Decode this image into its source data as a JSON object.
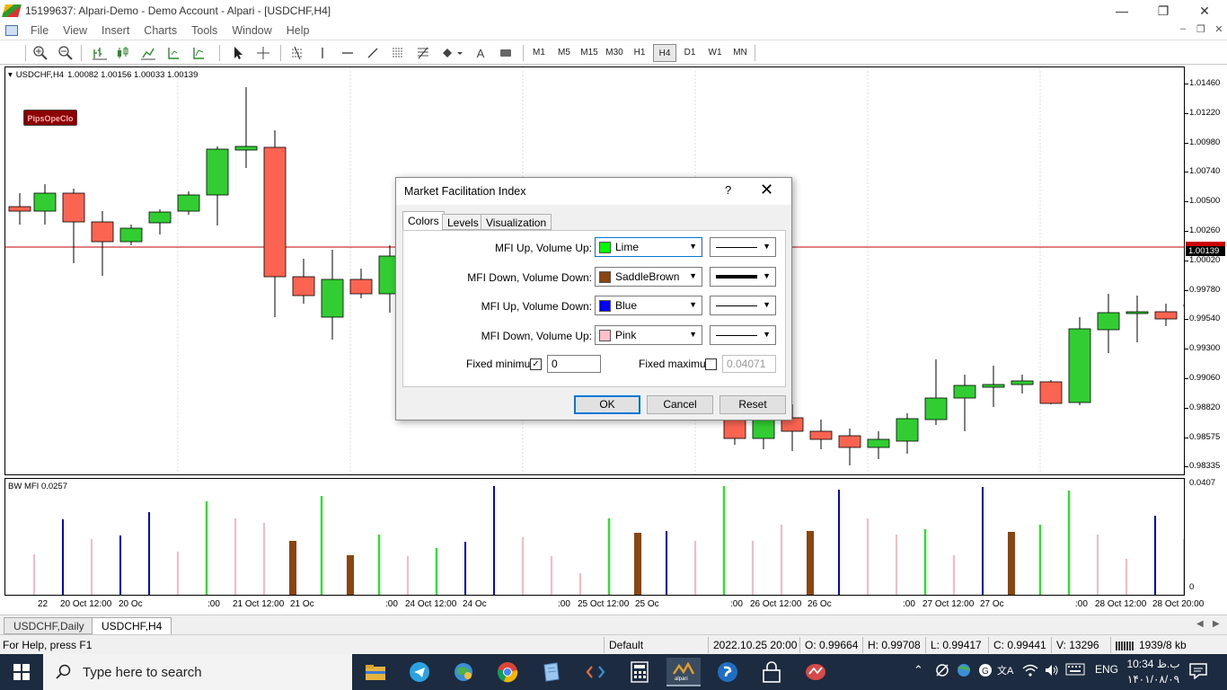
{
  "window": {
    "title": "15199637: Alpari-Demo - Demo Account - Alpari - [USDCHF,H4]",
    "minimize": "—",
    "maximize": "❐",
    "close": "✕"
  },
  "menu": {
    "items": [
      "File",
      "View",
      "Insert",
      "Charts",
      "Tools",
      "Window",
      "Help"
    ],
    "mdi_min": "–",
    "mdi_restore": "❐",
    "mdi_close": "✕"
  },
  "toolbar": {
    "timeframes": [
      "M1",
      "M5",
      "M15",
      "M30",
      "H1",
      "H4",
      "D1",
      "W1",
      "MN"
    ],
    "active_timeframe": "H4",
    "text_tool": "A"
  },
  "chart": {
    "header_symbol": "USDCHF,H4",
    "header_ohlc": "1.00082 1.00156 1.00033 1.00139",
    "badge": "PipsOpeClo",
    "current_price": "1.00139",
    "price_labels": [
      "1.01460",
      "1.01220",
      "1.00980",
      "1.00740",
      "1.00500",
      "1.00260",
      "1.00020",
      "0.99780",
      "0.99540",
      "0.99300",
      "0.99060",
      "0.98820",
      "0.98575",
      "0.98335"
    ],
    "colors": {
      "bull": "#32cd32",
      "bear": "#fa6450",
      "price_line": "#c00000"
    }
  },
  "indicator": {
    "header": "BW MFI 0.0257",
    "axis_top": "0.0407",
    "axis_bottom": "0"
  },
  "time_axis": {
    "labels": [
      "22",
      "20 Oct 12:00",
      "20 Oc",
      "21 Oct 12:00",
      "21 Oc",
      "24 Oct 12:00",
      "24 Oc",
      "25 Oct 12:00",
      "25 Oc",
      "26 Oct 12:00",
      "26 Oc",
      "27 Oct 12:00",
      "27 Oc",
      "28 Oct 12:00",
      "28 Oct 20:00"
    ],
    "minute_marks": [
      ":00",
      ":00",
      ":00",
      ":00",
      ":00",
      ":00"
    ]
  },
  "tabs": {
    "items": [
      "USDCHF,Daily",
      "USDCHF,H4"
    ],
    "active": "USDCHF,H4"
  },
  "status": {
    "help": "For Help, press F1",
    "profile": "Default",
    "time": "2022.10.25 20:00",
    "open": "O: 0.99664",
    "high": "H: 0.99708",
    "low": "L: 0.99417",
    "close": "C: 0.99441",
    "volume": "V: 13296",
    "traffic": "1939/8 kb"
  },
  "dialog": {
    "title": "Market Facilitation Index",
    "help": "?",
    "close": "✕",
    "tabs": [
      "Colors",
      "Levels",
      "Visualization"
    ],
    "active_tab": "Colors",
    "rows": [
      {
        "label": "MFI Up, Volume Up:",
        "color_name": "Lime",
        "swatch": "#00ff00",
        "line_width": 1
      },
      {
        "label": "MFI Down, Volume Down:",
        "color_name": "SaddleBrown",
        "swatch": "#8b4513",
        "line_width": 4
      },
      {
        "label": "MFI Up, Volume Down:",
        "color_name": "Blue",
        "swatch": "#0000ff",
        "line_width": 1
      },
      {
        "label": "MFI Down, Volume Up:",
        "color_name": "Pink",
        "swatch": "#ffc0cb",
        "line_width": 1
      }
    ],
    "fixed_minimum_label": "Fixed minimum",
    "fixed_minimum_checked": true,
    "fixed_minimum_value": "0",
    "fixed_maximum_label": "Fixed maximum",
    "fixed_maximum_checked": false,
    "fixed_maximum_value": "0.04071",
    "ok": "OK",
    "cancel": "Cancel",
    "reset": "Reset"
  },
  "taskbar": {
    "search_placeholder": "Type here to search",
    "language": "ENG",
    "clock_time": "10:34 ب.ظ",
    "clock_date": "۱۴۰۱/۰۸/۰۹"
  }
}
